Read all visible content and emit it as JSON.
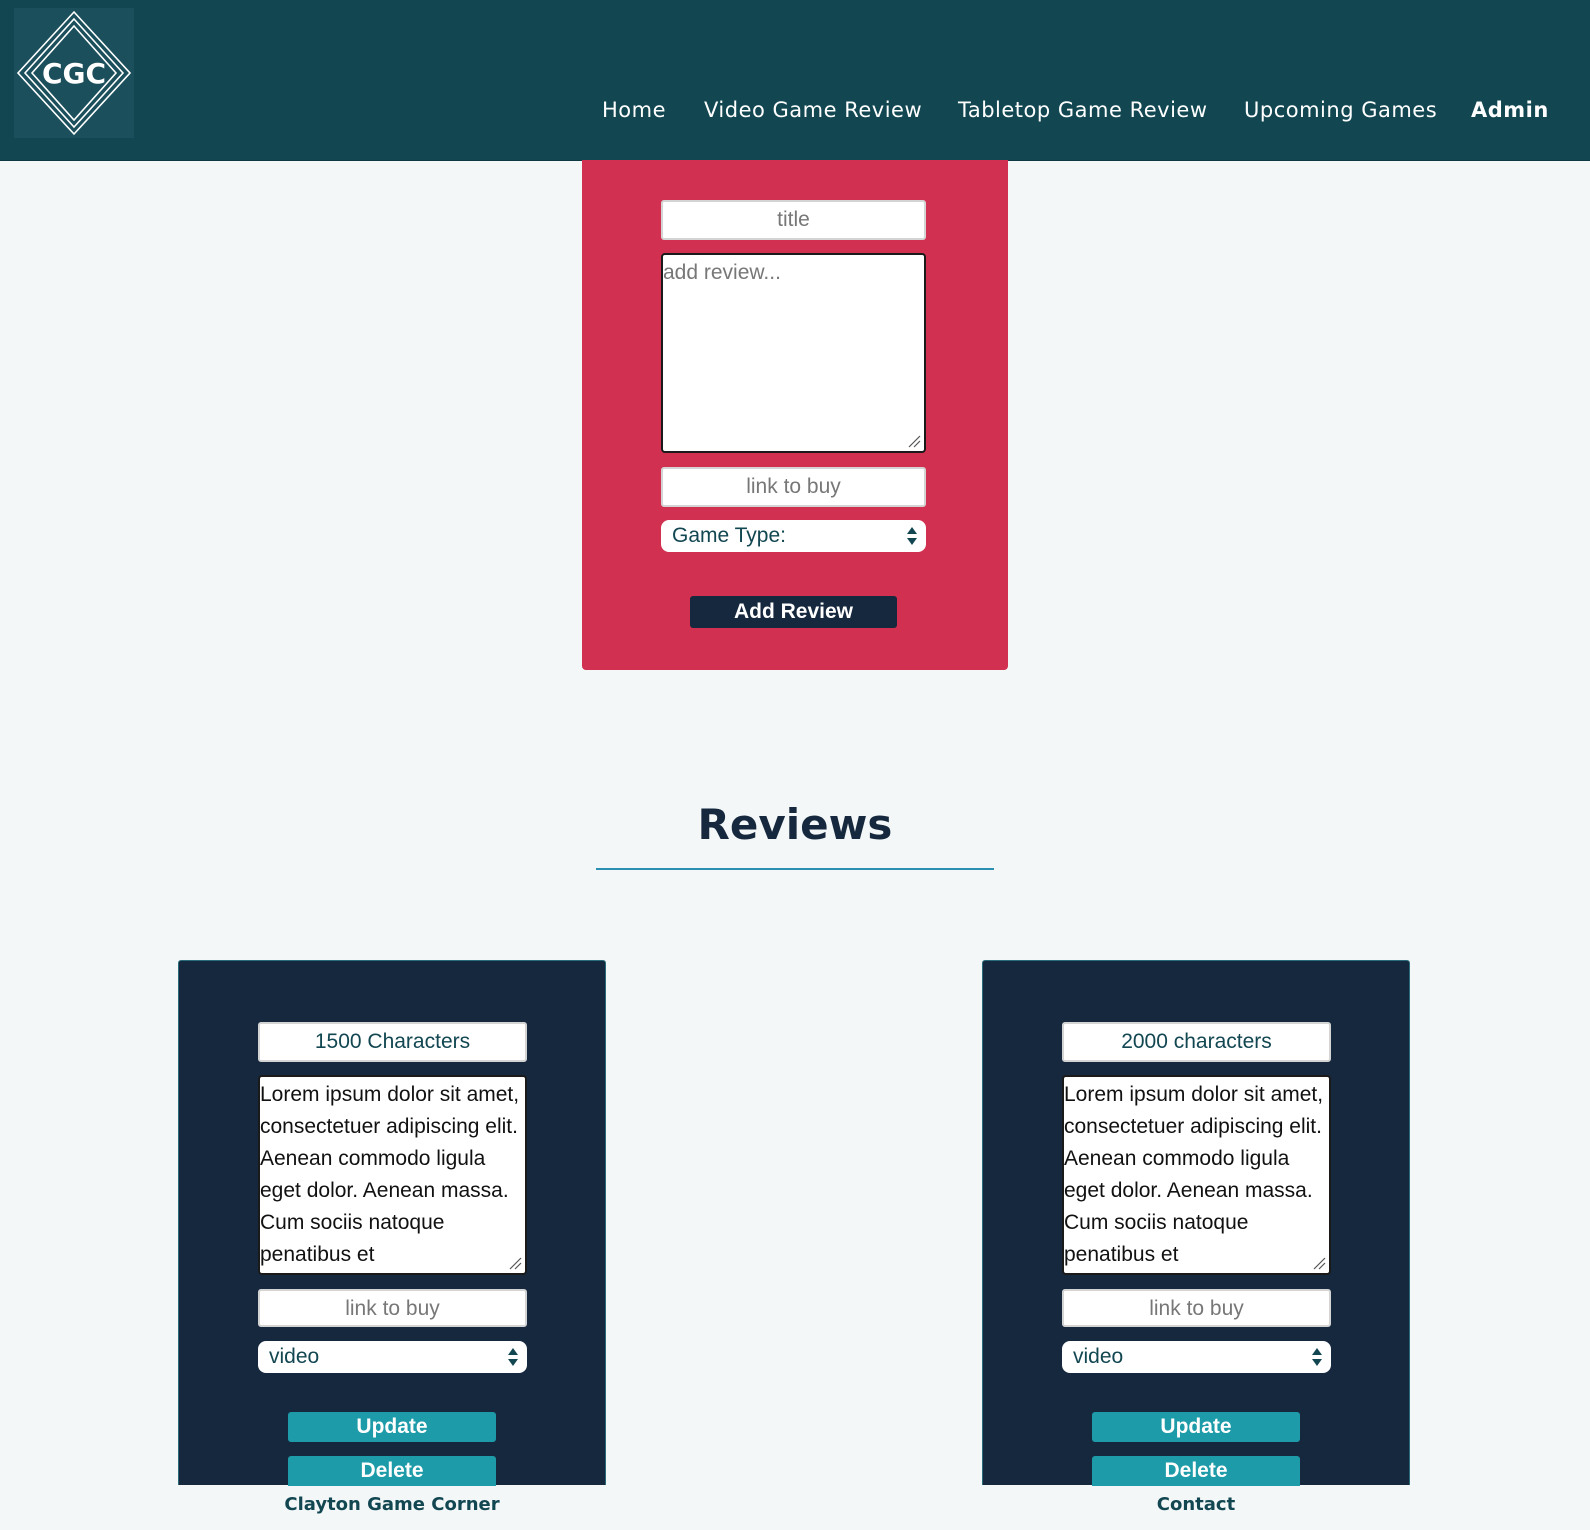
{
  "header": {
    "logo_text": "CGC",
    "nav": [
      {
        "label": "Home"
      },
      {
        "label": "Video Game Review"
      },
      {
        "label": "Tabletop Game Review"
      },
      {
        "label": "Upcoming Games"
      },
      {
        "label": "Admin"
      }
    ]
  },
  "add_form": {
    "title_placeholder": "title",
    "review_placeholder": "add review...",
    "link_placeholder": "link to buy",
    "game_type_label": "Game Type:",
    "submit_label": "Add Review"
  },
  "reviews": {
    "heading": "Reviews",
    "items": [
      {
        "title": "1500 Characters",
        "body": "Lorem ipsum dolor sit amet, consectetuer adipiscing elit. Aenean commodo ligula eget dolor. Aenean massa. Cum sociis natoque penatibus et",
        "link_placeholder": "link to buy",
        "game_type": "video",
        "update_label": "Update",
        "delete_label": "Delete"
      },
      {
        "title": "2000 characters",
        "body": "Lorem ipsum dolor sit amet, consectetuer adipiscing elit. Aenean commodo ligula eget dolor. Aenean massa. Cum sociis natoque penatibus et",
        "link_placeholder": "link to buy",
        "game_type": "video",
        "update_label": "Update",
        "delete_label": "Delete"
      }
    ]
  },
  "footer": {
    "left_label": "Clayton Game Corner",
    "right_label": "Contact"
  },
  "colors": {
    "header_bg": "#124752",
    "form_panel": "#d13050",
    "card_bg": "#16283e",
    "button_teal": "#1e9ba8",
    "page_bg": "#f3f7f8"
  }
}
